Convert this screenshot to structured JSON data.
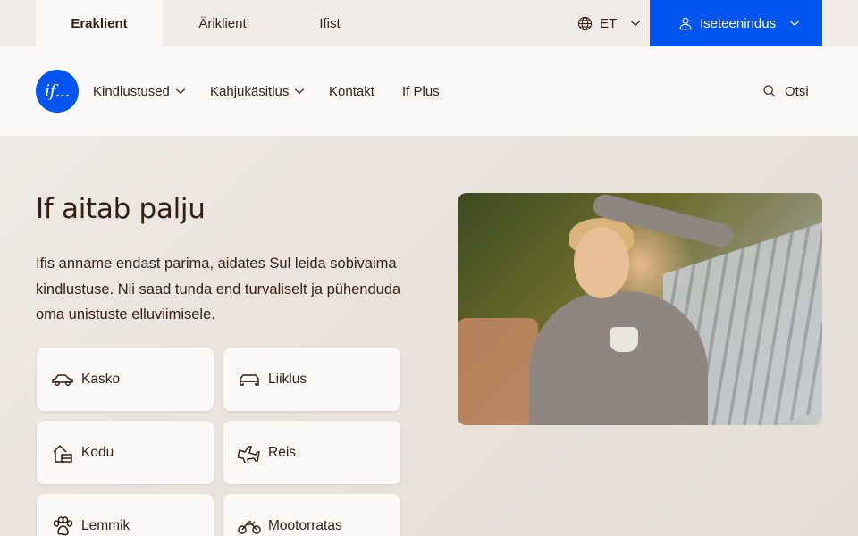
{
  "topbar": {
    "segments": [
      "Eraklient",
      "Äriklient",
      "Ifist"
    ],
    "language": "ET",
    "selfservice_label": "Iseteenindus"
  },
  "logo": {
    "text": "if..."
  },
  "nav": {
    "items": [
      {
        "label": "Kindlustused",
        "has_dropdown": true
      },
      {
        "label": "Kahjukäsitlus",
        "has_dropdown": true
      },
      {
        "label": "Kontakt",
        "has_dropdown": false
      },
      {
        "label": "If Plus",
        "has_dropdown": false
      }
    ],
    "search_label": "Otsi"
  },
  "hero": {
    "title": "If aitab palju",
    "lead": "Ifis anname endast parima, aidates Sul leida sobivaima kindlustuse. Nii saad tunda end turvaliselt ja pühenduda oma unistuste elluviimisele."
  },
  "products": [
    {
      "label": "Kasko",
      "icon": "car-icon"
    },
    {
      "label": "Liiklus",
      "icon": "car-front-icon"
    },
    {
      "label": "Kodu",
      "icon": "home-icon"
    },
    {
      "label": "Reis",
      "icon": "plane-icon"
    },
    {
      "label": "Lemmik",
      "icon": "paw-icon"
    },
    {
      "label": "Mootorratas",
      "icon": "motorcycle-icon"
    }
  ],
  "colors": {
    "brand_blue": "#0054f0",
    "text": "#331e11",
    "background": "#f1ece8",
    "card": "#faf9f7"
  }
}
